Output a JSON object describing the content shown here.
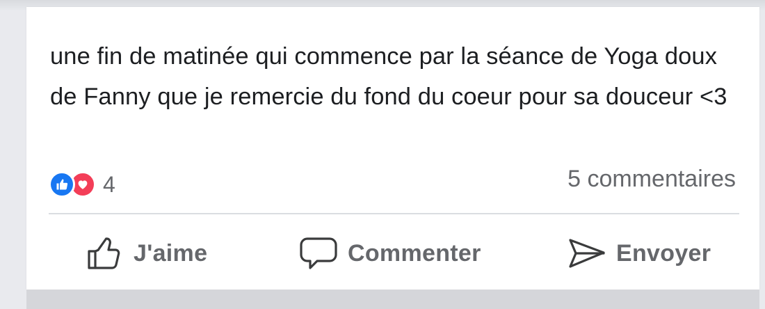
{
  "post": {
    "text": "une fin de matinée qui commence par la séance de Yoga doux de Fanny que je remercie du fond du coeur pour sa douceur <3"
  },
  "reactions": {
    "count": "4",
    "types": [
      "like-icon",
      "heart-icon"
    ],
    "comments_label": "5 commentaires"
  },
  "actions": {
    "like_label": "J'aime",
    "comment_label": "Commenter",
    "send_label": "Envoyer"
  },
  "colors": {
    "like_blue": "#1877f2",
    "love_red": "#f33e58",
    "secondary_text": "#65676b",
    "primary_text": "#1c1e21"
  }
}
